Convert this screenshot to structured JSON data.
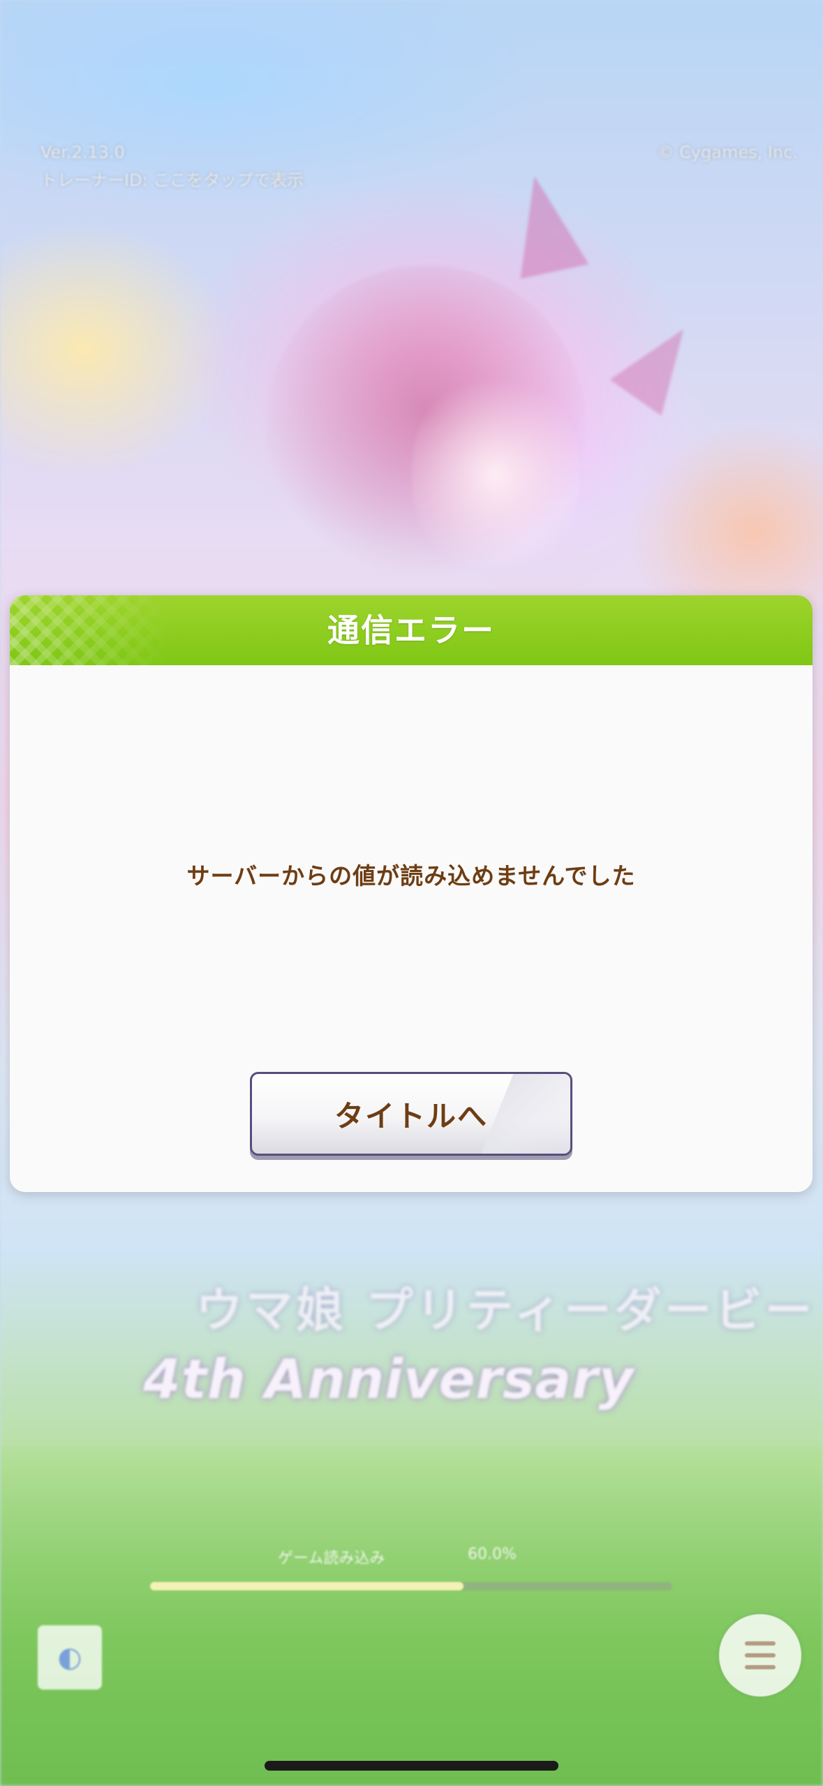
{
  "background": {
    "version": "Ver.2.13.0",
    "trainer_id": "トレーナーID: ここをタップで表示",
    "copyright": "© Cygames, Inc.",
    "logo_jp": "ウマ娘 プリティーダービー",
    "logo_en": "4th Anniversary",
    "loading_label": "ゲーム読み込み",
    "loading_percent": "60.0%",
    "progress": 0.6,
    "support_badge_icon": "support-badge-icon",
    "menu_icon": "hamburger-menu-icon"
  },
  "dialog": {
    "title": "通信エラー",
    "message": "サーバーからの値が読み込めませんでした",
    "button_label": "タイトルへ"
  },
  "colors": {
    "header_green": "#86c91a",
    "text_brown": "#6e3d13",
    "button_border": "#5a4c7e"
  }
}
